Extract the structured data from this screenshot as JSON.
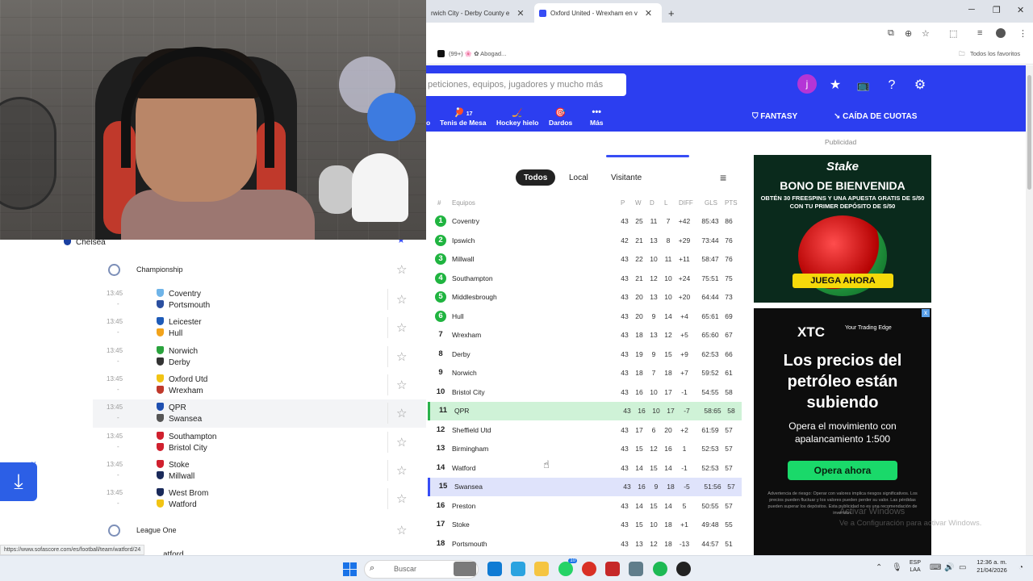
{
  "browser": {
    "tabs": [
      {
        "label": "rwich City - Derby County e",
        "active": false
      },
      {
        "label": "Oxford United - Wrexham en v",
        "active": true
      }
    ],
    "new_tab": "+",
    "bookmarks": [
      {
        "label": "(99+) 🌸 ✿ Abogad..."
      }
    ],
    "bookmarks_right": "Todos los favoritos"
  },
  "header": {
    "search_placeholder": "peticiones, equipos, jugadores y mucho más",
    "avatar_letter": "j",
    "sports": [
      {
        "label": "o",
        "badge": ""
      },
      {
        "label": "Tenis de Mesa",
        "badge": "17"
      },
      {
        "label": "Hockey hielo",
        "badge": ""
      },
      {
        "label": "Dardos",
        "badge": ""
      },
      {
        "label": "Más",
        "badge": ""
      }
    ],
    "fantasy_label": "FANTASY",
    "odds_label": "CAÍDA DE CUOTAS"
  },
  "sidebar": {
    "partial_top": "Chelsea",
    "league1": "Championship",
    "matches": [
      {
        "time": "13:45",
        "home": "Coventry",
        "away": "Portsmouth",
        "home_color": "#6fb4e8",
        "away_color": "#2b4fa0",
        "highlight": false
      },
      {
        "time": "13:45",
        "home": "Leicester",
        "away": "Hull",
        "home_color": "#1e5bb8",
        "away_color": "#f2a31b",
        "highlight": false
      },
      {
        "time": "13:45",
        "home": "Norwich",
        "away": "Derby",
        "home_color": "#2aa33d",
        "away_color": "#333333",
        "highlight": false
      },
      {
        "time": "13:45",
        "home": "Oxford Utd",
        "away": "Wrexham",
        "home_color": "#f2c414",
        "away_color": "#c0392b",
        "highlight": false
      },
      {
        "time": "13:45",
        "home": "QPR",
        "away": "Swansea",
        "home_color": "#1e4fb0",
        "away_color": "#555555",
        "highlight": true
      },
      {
        "time": "13:45",
        "home": "Southampton",
        "away": "Bristol City",
        "home_color": "#d0202e",
        "away_color": "#d0202e",
        "highlight": false
      },
      {
        "time": "13:45",
        "home": "Stoke",
        "away": "Millwall",
        "home_color": "#d0202e",
        "away_color": "#1a2a5a",
        "highlight": false
      },
      {
        "time": "13:45",
        "home": "West Brom",
        "away": "Watford",
        "home_color": "#1a2a5a",
        "away_color": "#f2c414",
        "highlight": false
      }
    ],
    "league2": "League One",
    "partial_bottom": "atford",
    "match_dash": "-",
    "status_url": "https://www.sofascore.com/es/football/team/watford/24"
  },
  "standings": {
    "filters": [
      "Todos",
      "Local",
      "Visitante"
    ],
    "active_filter": "Todos",
    "columns": {
      "pos": "#",
      "team": "Equipos",
      "p": "P",
      "w": "W",
      "d": "D",
      "l": "L",
      "diff": "DIFF",
      "gls": "GLS",
      "pts": "PTS"
    },
    "rows": [
      {
        "pos": "1",
        "team": "Coventry",
        "p": "43",
        "w": "25",
        "d": "11",
        "l": "7",
        "diff": "+42",
        "gls": "85:43",
        "pts": "86",
        "zone": "green",
        "hl": ""
      },
      {
        "pos": "2",
        "team": "Ipswich",
        "p": "42",
        "w": "21",
        "d": "13",
        "l": "8",
        "diff": "+29",
        "gls": "73:44",
        "pts": "76",
        "zone": "green",
        "hl": ""
      },
      {
        "pos": "3",
        "team": "Millwall",
        "p": "43",
        "w": "22",
        "d": "10",
        "l": "11",
        "diff": "+11",
        "gls": "58:47",
        "pts": "76",
        "zone": "green",
        "hl": ""
      },
      {
        "pos": "4",
        "team": "Southampton",
        "p": "43",
        "w": "21",
        "d": "12",
        "l": "10",
        "diff": "+24",
        "gls": "75:51",
        "pts": "75",
        "zone": "green",
        "hl": ""
      },
      {
        "pos": "5",
        "team": "Middlesbrough",
        "p": "43",
        "w": "20",
        "d": "13",
        "l": "10",
        "diff": "+20",
        "gls": "64:44",
        "pts": "73",
        "zone": "green",
        "hl": ""
      },
      {
        "pos": "6",
        "team": "Hull",
        "p": "43",
        "w": "20",
        "d": "9",
        "l": "14",
        "diff": "+4",
        "gls": "65:61",
        "pts": "69",
        "zone": "green",
        "hl": ""
      },
      {
        "pos": "7",
        "team": "Wrexham",
        "p": "43",
        "w": "18",
        "d": "13",
        "l": "12",
        "diff": "+5",
        "gls": "65:60",
        "pts": "67",
        "zone": "",
        "hl": ""
      },
      {
        "pos": "8",
        "team": "Derby",
        "p": "43",
        "w": "19",
        "d": "9",
        "l": "15",
        "diff": "+9",
        "gls": "62:53",
        "pts": "66",
        "zone": "",
        "hl": ""
      },
      {
        "pos": "9",
        "team": "Norwich",
        "p": "43",
        "w": "18",
        "d": "7",
        "l": "18",
        "diff": "+7",
        "gls": "59:52",
        "pts": "61",
        "zone": "",
        "hl": ""
      },
      {
        "pos": "10",
        "team": "Bristol City",
        "p": "43",
        "w": "16",
        "d": "10",
        "l": "17",
        "diff": "-1",
        "gls": "54:55",
        "pts": "58",
        "zone": "",
        "hl": ""
      },
      {
        "pos": "11",
        "team": "QPR",
        "p": "43",
        "w": "16",
        "d": "10",
        "l": "17",
        "diff": "-7",
        "gls": "58:65",
        "pts": "58",
        "zone": "",
        "hl": "green"
      },
      {
        "pos": "12",
        "team": "Sheffield Utd",
        "p": "43",
        "w": "17",
        "d": "6",
        "l": "20",
        "diff": "+2",
        "gls": "61:59",
        "pts": "57",
        "zone": "",
        "hl": ""
      },
      {
        "pos": "13",
        "team": "Birmingham",
        "p": "43",
        "w": "15",
        "d": "12",
        "l": "16",
        "diff": "1",
        "gls": "52:53",
        "pts": "57",
        "zone": "",
        "hl": ""
      },
      {
        "pos": "14",
        "team": "Watford",
        "p": "43",
        "w": "14",
        "d": "15",
        "l": "14",
        "diff": "-1",
        "gls": "52:53",
        "pts": "57",
        "zone": "",
        "hl": ""
      },
      {
        "pos": "15",
        "team": "Swansea",
        "p": "43",
        "w": "16",
        "d": "9",
        "l": "18",
        "diff": "-5",
        "gls": "51:56",
        "pts": "57",
        "zone": "",
        "hl": "blue"
      },
      {
        "pos": "16",
        "team": "Preston",
        "p": "43",
        "w": "14",
        "d": "15",
        "l": "14",
        "diff": "5",
        "gls": "50:55",
        "pts": "57",
        "zone": "",
        "hl": ""
      },
      {
        "pos": "17",
        "team": "Stoke",
        "p": "43",
        "w": "15",
        "d": "10",
        "l": "18",
        "diff": "+1",
        "gls": "49:48",
        "pts": "55",
        "zone": "",
        "hl": ""
      },
      {
        "pos": "18",
        "team": "Portsmouth",
        "p": "43",
        "w": "13",
        "d": "12",
        "l": "18",
        "diff": "-13",
        "gls": "44:57",
        "pts": "51",
        "zone": "",
        "hl": ""
      }
    ]
  },
  "ads": {
    "label": "Publicidad",
    "ad1": {
      "brand": "Stake",
      "headline": "BONO DE BIENVENIDA",
      "sub": "OBTÉN 30 FREESPINS Y UNA APUESTA GRATIS DE S/50 CON TU PRIMER DEPÓSITO DE S/50",
      "cta": "JUEGA AHORA"
    },
    "ad2": {
      "brand": "XTC",
      "brand_sub": "Your Trading Edge",
      "headline": "Los precios del petróleo están subiendo",
      "body": "Opera el movimiento con apalancamiento 1:500",
      "cta": "Opera ahora",
      "fine": "Advertencia de riesgo: Operar con valores implica riesgos significativos. Los precios pueden fluctuar y los valores pueden perder su valor. Las pérdidas pueden superar los depósitos. Esta publicidad no es una recomendación de inversión.",
      "close": "x"
    },
    "watermark1": "Activar Windows",
    "watermark2": "Ve a Configuración para activar Windows."
  },
  "taskbar": {
    "search_placeholder": "Buscar",
    "whatsapp_badge": "10",
    "lang_top": "ESP",
    "lang_bottom": "LAA",
    "time": "12:36 a. m.",
    "date": "21/04/2026",
    "app_colors": [
      "#7a7a7a",
      "#0f7bd4",
      "#2aa3e0",
      "#f5c542",
      "#25d366",
      "#d93025",
      "#c62828",
      "#607d8b",
      "#1db954",
      "#222222"
    ]
  }
}
